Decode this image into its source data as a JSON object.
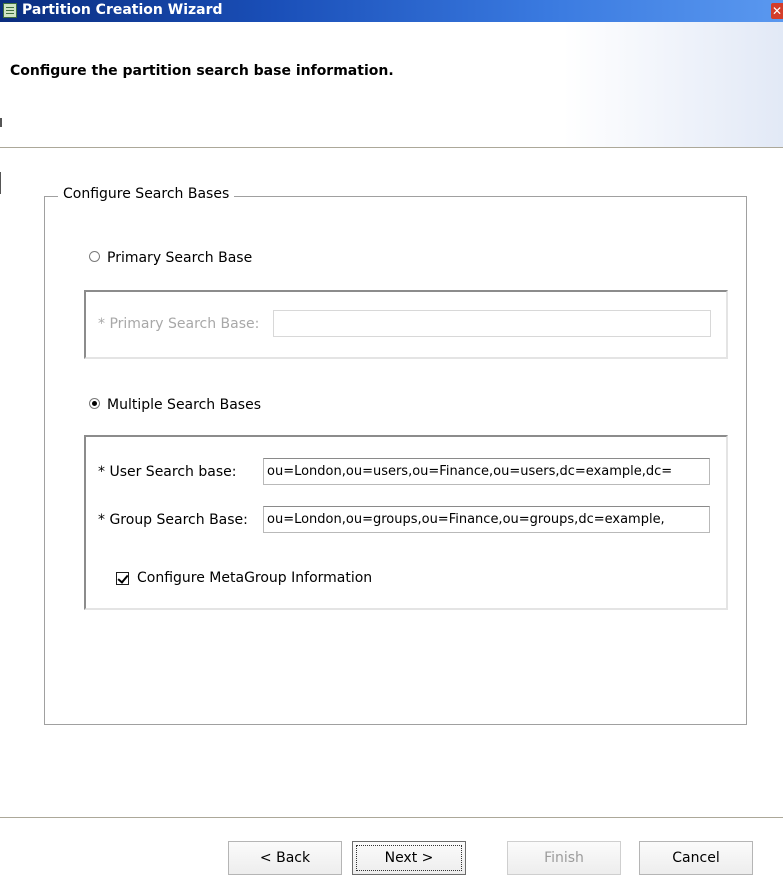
{
  "window": {
    "title": "Partition Creation Wizard",
    "close_glyph": "✕",
    "icon": "wizard-page-icon"
  },
  "header": {
    "title": "Configure the partition search base information."
  },
  "group": {
    "legend": "Configure Search Bases"
  },
  "primary": {
    "radio_label": "Primary Search Base",
    "selected": false,
    "field_label": "* Primary Search Base:",
    "value": "",
    "enabled": false
  },
  "multiple": {
    "radio_label": "Multiple Search Bases",
    "selected": true,
    "user_label": "* User Search base:",
    "user_value": "ou=London,ou=users,ou=Finance,ou=users,dc=example,dc=",
    "group_label": "* Group Search Base:",
    "group_value": "ou=London,ou=groups,ou=Finance,ou=groups,dc=example,",
    "metagroup_label": "Configure MetaGroup Information",
    "metagroup_checked": true
  },
  "buttons": {
    "back": "< Back",
    "next": "Next >",
    "finish": "Finish",
    "cancel": "Cancel"
  },
  "colors": {
    "titlebar_start": "#0a2d7e",
    "titlebar_end": "#5a98ef",
    "close_button": "#d33d2a"
  }
}
